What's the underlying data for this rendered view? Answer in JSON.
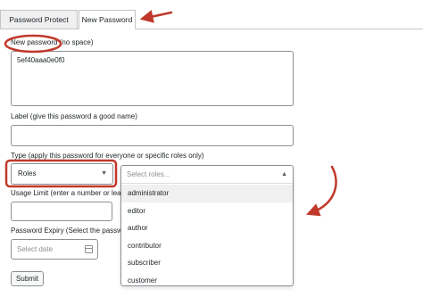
{
  "tabs": [
    {
      "label": "Password Protect"
    },
    {
      "label": "New Password"
    }
  ],
  "form": {
    "password_label": "New password (no space)",
    "password_value": "5ef40aaa0e0f0",
    "name_label": "Label (give this password a good name)",
    "name_value": "",
    "type_label": "Type (apply this password for everyone or specific roles only)",
    "type_selected": "Roles",
    "roles_placeholder": "Select roles...",
    "roles_options": [
      "administrator",
      "editor",
      "author",
      "contributor",
      "subscriber",
      "customer"
    ],
    "usage_label": "Usage Limit (enter a number or leave",
    "usage_value": "",
    "expiry_label": "Password Expiry (Select the password",
    "expiry_placeholder": "Select date",
    "submit_label": "Submit"
  },
  "colors": {
    "annotation": "#c0392b",
    "border": "#8c8f94",
    "highlight": "#f0f0f1"
  }
}
